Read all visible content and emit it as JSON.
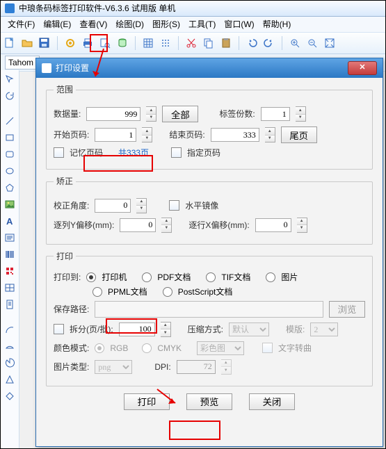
{
  "app_title": "中琅条码标签打印软件-V6.3.6 试用版 单机",
  "menus": [
    "文件(F)",
    "编辑(E)",
    "查看(V)",
    "绘图(D)",
    "图形(S)",
    "工具(T)",
    "窗口(W)",
    "帮助(H)"
  ],
  "font_sample": "Tahom",
  "dialog": {
    "title": "打印设置",
    "close_glyph": "✕",
    "group_range": "范围",
    "lbl_dataqty": "数据量:",
    "val_dataqty": "999",
    "btn_all": "全部",
    "lbl_copies": "标签份数:",
    "val_copies": "1",
    "lbl_startpage": "开始页码:",
    "val_startpage": "1",
    "lbl_endpage": "结束页码:",
    "val_endpage": "333",
    "btn_lastpage": "尾页",
    "chk_remember": "记忆页码",
    "link_pages": "共333页",
    "chk_specify": "指定页码",
    "group_correct": "矫正",
    "lbl_angle": "校正角度:",
    "val_angle": "0",
    "chk_mirror": "水平镜像",
    "lbl_yoffset": "逐列Y偏移(mm):",
    "val_yoffset": "0",
    "lbl_xoffset": "逐行X偏移(mm):",
    "val_xoffset": "0",
    "group_print": "打印",
    "lbl_printto": "打印到:",
    "opt_printer": "打印机",
    "opt_pdf": "PDF文档",
    "opt_tif": "TIF文档",
    "opt_pic": "图片",
    "opt_ppml": "PPML文档",
    "opt_ps": "PostScript文档",
    "lbl_savepath": "保存路径:",
    "btn_browse": "浏览",
    "chk_split": "拆分(页/批):",
    "val_split": "100",
    "lbl_compress": "压缩方式:",
    "val_compress": "默认",
    "lbl_template": "模版:",
    "val_template": "2",
    "lbl_colormode": "颜色模式:",
    "opt_rgb": "RGB",
    "opt_cmyk": "CMYK",
    "val_colorsel": "彩色图",
    "chk_textcurve": "文字转曲",
    "lbl_pictype": "图片类型:",
    "val_pictype": "png",
    "lbl_dpi": "DPI:",
    "val_dpi": "72",
    "btn_print": "打印",
    "btn_preview": "预览",
    "btn_close": "关闭"
  }
}
